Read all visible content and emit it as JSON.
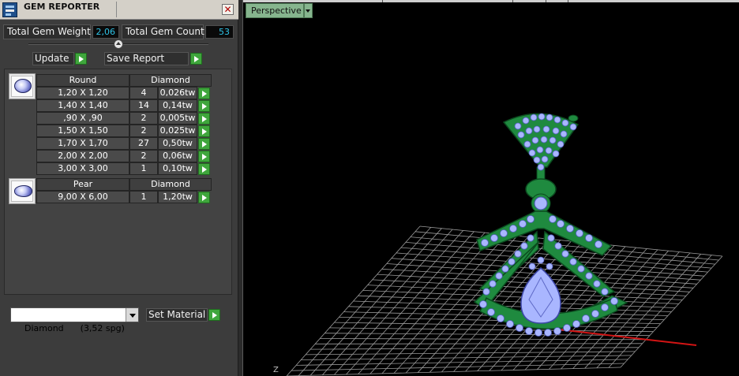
{
  "panel": {
    "title": "GEM REPORTER",
    "close_glyph": "✕",
    "total_weight_label": "Total Gem Weight",
    "total_weight_value": "2,06",
    "total_count_label": "Total Gem Count",
    "total_count_value": "53",
    "update_label": "Update",
    "save_report_label": "Save Report",
    "set_material_label": "Set Material",
    "material_value": "Diamond      (3,52 spg)"
  },
  "gem_groups": [
    {
      "shape": "Round",
      "material": "Diamond",
      "icon": "round-gem-icon",
      "rows": [
        {
          "size": "1,20 X 1,20",
          "count": "4",
          "weight": "0,026tw"
        },
        {
          "size": "1,40 X 1,40",
          "count": "14",
          "weight": "0,14tw"
        },
        {
          "size": ",90 X ,90",
          "count": "2",
          "weight": "0,005tw"
        },
        {
          "size": "1,50 X 1,50",
          "count": "2",
          "weight": "0,025tw"
        },
        {
          "size": "1,70 X 1,70",
          "count": "27",
          "weight": "0,50tw"
        },
        {
          "size": "2,00 X 2,00",
          "count": "2",
          "weight": "0,06tw"
        },
        {
          "size": "3,00 X 3,00",
          "count": "1",
          "weight": "0,10tw"
        }
      ]
    },
    {
      "shape": "Pear",
      "material": "Diamond",
      "icon": "pear-gem-icon",
      "rows": [
        {
          "size": "9,00 X 6,00",
          "count": "1",
          "weight": "1,20tw"
        }
      ]
    }
  ],
  "viewport": {
    "view_mode": "Perspective",
    "axis_label": "Z",
    "colors": {
      "metal": "#1f8a3f",
      "gem": "#a9b6ff",
      "grid": "#9a9a9a",
      "x_axis": "#d21414",
      "view_tab": "#86b58e",
      "value_text": "#2ec3e6",
      "play_button": "#3fa63c"
    }
  }
}
